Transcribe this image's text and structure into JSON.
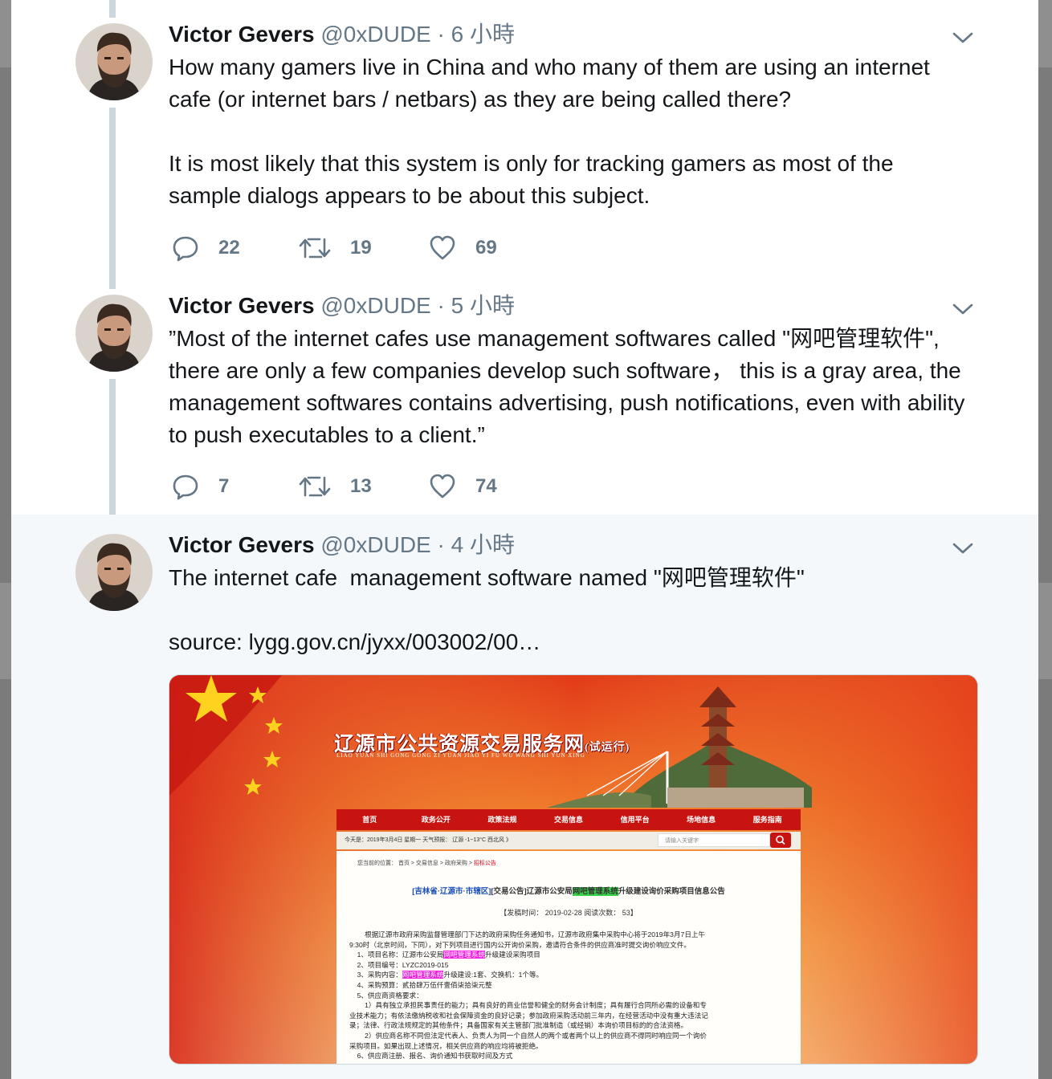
{
  "theme": {
    "accent": "#1da1f2",
    "text": "#14171a",
    "muted": "#657786",
    "border": "#ccd6dd",
    "highlight_bg": "#f5f8fa"
  },
  "tweets": [
    {
      "name": "Victor Gevers",
      "handle": "@0xDUDE",
      "dot": "·",
      "time": "6 小時",
      "text": "How many gamers live in China and who many of them are using an internet cafe (or internet bars / netbars) as they are being called there?\n\nIt is most likely that this system is only for tracking gamers as most of the sample dialogs appears to be about this subject.",
      "replies": "22",
      "retweets": "19",
      "likes": "69"
    },
    {
      "name": "Victor Gevers",
      "handle": "@0xDUDE",
      "dot": "·",
      "time": "5 小時",
      "text": "”Most of the internet cafes use management softwares called \"网吧管理软件\", there are only a few companies develop such software， this is a gray area, the management softwares contains advertising, push notifications, even with ability to push executables to a client.”",
      "replies": "7",
      "retweets": "13",
      "likes": "74"
    },
    {
      "name": "Victor Gevers",
      "handle": "@0xDUDE",
      "dot": "·",
      "time": "4 小時",
      "text": "The internet cafe  management software named \"网吧管理软件\"\n\nsource: lygg.gov.cn/jyxx/003002/00…"
    }
  ],
  "icons": {
    "reply": "reply-icon",
    "retweet": "retweet-icon",
    "like": "heart-icon",
    "caret": "chevron-down-icon",
    "search": "search-icon"
  },
  "embed": {
    "site_title": "辽源市公共资源交易服务网",
    "site_title_suffix": "(试运行)",
    "site_subtitle": "LIAO YUAN SHI GONG GONG ZI YUAN JIAO YI FU WU WANG SHI YUN XING",
    "nav": [
      "首页",
      "政务公开",
      "政策法规",
      "交易信息",
      "信用平台",
      "场地信息",
      "服务指南"
    ],
    "info_bar": "今天是：2019年3月4日  星期一 天气预报：  辽源    -1~13°C 西北风 》",
    "search_placeholder": "请输入关键字",
    "breadcrumb": "您当前的位置：  首页 > 交易信息 > 政府采购 > ",
    "breadcrumb_current": "招标公告",
    "doc_title_region": "[吉林省·辽源市·市辖区]",
    "doc_title_pre": "[交易公告]辽源市公安局",
    "doc_title_mark": "网吧管理系统",
    "doc_title_post": "升级建设询价采购项目信息公告",
    "doc_meta": "【发稿时间：  2019-02-28    阅读次数：  53】",
    "para1": "        根据辽源市政府采购监督管理部门下达的政府采购任务通知书，辽源市政府集中采购中心将于2019年3月7日上午\n9:30时（北京时间，下同），对下列项目进行国内公开询价采购，邀请符合条件的供应商准时提交询价响应文件。",
    "item1_pre": "    1、项目名称：辽源市公安局",
    "item1_mark": "网吧管理系统",
    "item1_post": "升级建设采购项目",
    "item2": "    2、项目编号：LYZC2019-015",
    "item3_pre": "    3、采购内容：",
    "item3_mark": "网吧管理系统",
    "item3_post": "升级建设:1套、交换机：1个等。",
    "item4": "    4、采购预算：贰拾肆万伍仟壹佰柒拾柒元整",
    "item5": "    5、供应商资格要求：\n        1）具有独立承担民事责任的能力；具有良好的商业信誉和健全的财务会计制度；具有履行合同所必需的设备和专\n业技术能力；有依法缴纳税收和社会保障资金的良好记录；参加政府采购活动前三年内，在经营活动中没有重大违法记\n录；法律、行政法规规定的其他条件；具备国家有关主管部门批准制造（或经销）本询价项目标的的合法资格。\n        2）供应商名称不同但法定代表人、负责人为同一个自然人的两个或者两个以上的供应商不得同时响应同一个询价\n采购项目。如果出现上述情况，相关供应商的响应均将被拒绝。\n    6、供应商注册、报名、询价通知书获取时间及方式"
  }
}
